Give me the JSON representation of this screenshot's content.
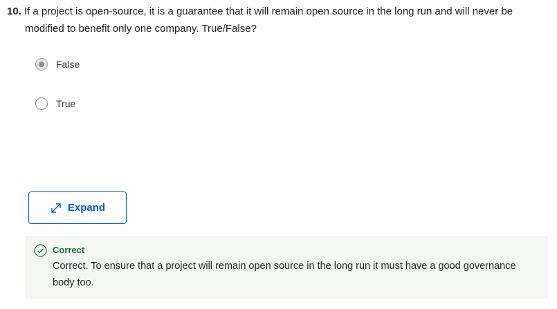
{
  "question": {
    "number": "10.",
    "text_line1": "If a project is open-source, it is a guarantee that it will remain open source in the long run and will never be",
    "text_line2": "modified to benefit only one company. True/False?"
  },
  "options": [
    {
      "label": "False",
      "selected": true
    },
    {
      "label": "True",
      "selected": false
    }
  ],
  "expand_button": {
    "label": "Expand",
    "icon": "expand-arrows-icon"
  },
  "feedback": {
    "status": "Correct",
    "icon": "check-circle-icon",
    "message": "Correct. To ensure that a project will remain open source in the long run it must have a good governance body too."
  },
  "colors": {
    "accent": "#0056d2",
    "success": "#1e6b34",
    "feedback_bg": "#f4f8f5"
  }
}
